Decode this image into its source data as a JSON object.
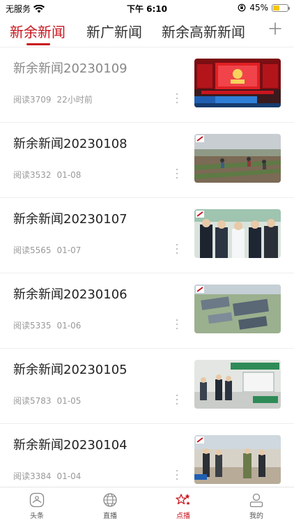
{
  "status": {
    "carrier": "无服务",
    "time": "下午 6:10",
    "battery": "45%",
    "battery_level": 0.45
  },
  "tabs": [
    {
      "label": "新余新闻",
      "active": true
    },
    {
      "label": "新广新闻",
      "active": false
    },
    {
      "label": "新余高新新闻",
      "active": false
    }
  ],
  "news": [
    {
      "title": "新余新闻20230109",
      "reads": "阅读3709",
      "date": "22小时前",
      "read": true,
      "thumb": "stage-event"
    },
    {
      "title": "新余新闻20230108",
      "reads": "阅读3532",
      "date": "01-08",
      "read": false,
      "thumb": "farm-field"
    },
    {
      "title": "新余新闻20230107",
      "reads": "阅读5565",
      "date": "01-07",
      "read": false,
      "thumb": "hospital-visit"
    },
    {
      "title": "新余新闻20230106",
      "reads": "阅读5335",
      "date": "01-06",
      "read": false,
      "thumb": "aerial-factory"
    },
    {
      "title": "新余新闻20230105",
      "reads": "阅读5783",
      "date": "01-05",
      "read": false,
      "thumb": "service-hall"
    },
    {
      "title": "新余新闻20230104",
      "reads": "阅读3384",
      "date": "01-04",
      "read": false,
      "thumb": "outdoor-inspection"
    }
  ],
  "bottom_nav": [
    {
      "label": "头条",
      "icon": "headline-icon",
      "active": false
    },
    {
      "label": "直播",
      "icon": "globe-icon",
      "active": false
    },
    {
      "label": "点播",
      "icon": "stars-icon",
      "active": true
    },
    {
      "label": "我的",
      "icon": "person-icon",
      "active": false
    }
  ],
  "colors": {
    "accent": "#c9151e",
    "battery": "#f7c700"
  }
}
